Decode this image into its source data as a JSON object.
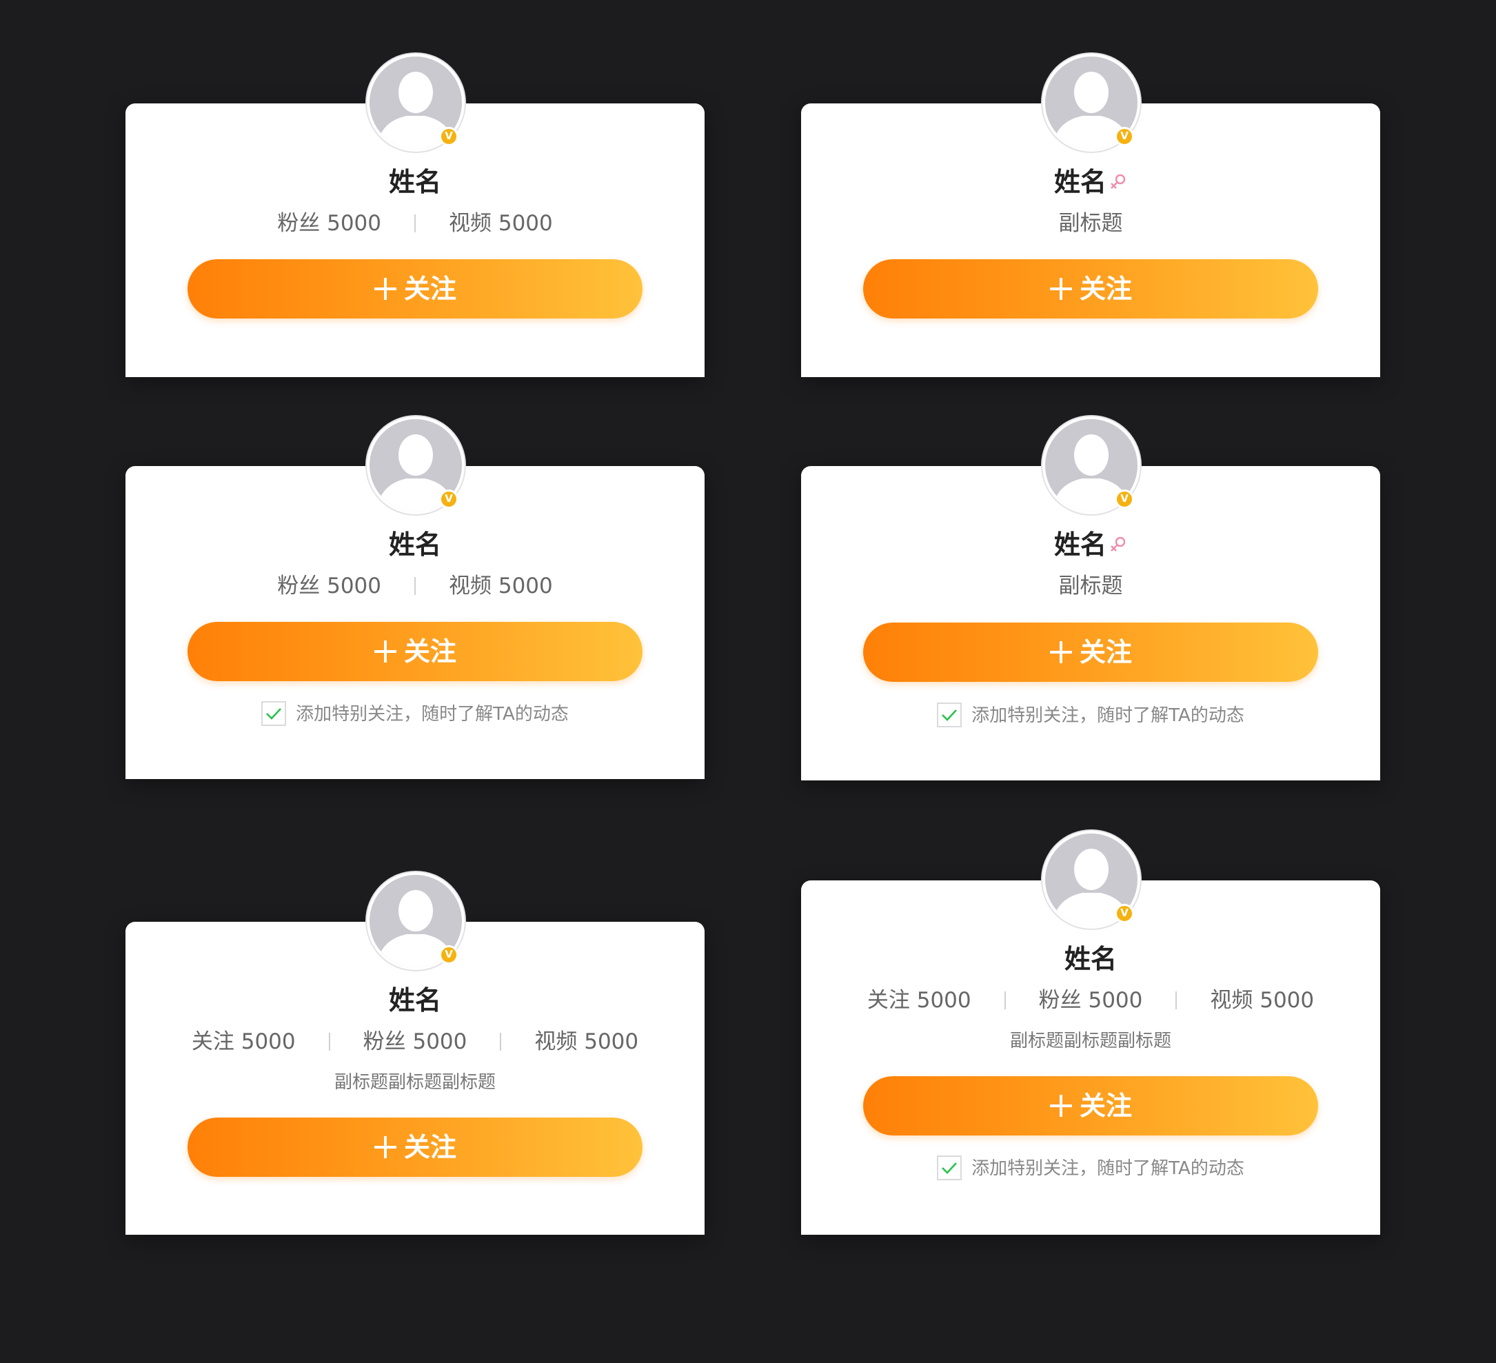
{
  "colors": {
    "page_background": "#1c1c1e",
    "card_background": "#ffffff",
    "button_gradient_start": "#ff8008",
    "button_gradient_end": "#ffc23a",
    "verified_badge": "#f5b210",
    "female_icon": "#f08cab",
    "checkmark": "#27c24c"
  },
  "icons": {
    "avatar": "default-user-silhouette",
    "verified": "v-badge",
    "gender": "female-symbol",
    "plus": "plus",
    "check": "checkmark"
  },
  "verified_badge_label": "V",
  "cards": [
    {
      "name": "姓名",
      "stats": [
        {
          "label": "粉丝 5000"
        },
        {
          "label": "视频 5000"
        }
      ],
      "follow_label": "关注"
    },
    {
      "name": "姓名",
      "subtitle": "副标题",
      "follow_label": "关注"
    },
    {
      "name": "姓名",
      "stats": [
        {
          "label": "粉丝 5000"
        },
        {
          "label": "视频 5000"
        }
      ],
      "follow_label": "关注",
      "special_follow_label": "添加特别关注，随时了解TA的动态",
      "special_follow_checked": true
    },
    {
      "name": "姓名",
      "subtitle": "副标题",
      "follow_label": "关注",
      "special_follow_label": "添加特别关注，随时了解TA的动态",
      "special_follow_checked": true
    },
    {
      "name": "姓名",
      "stats": [
        {
          "label": "关注 5000"
        },
        {
          "label": "粉丝 5000"
        },
        {
          "label": "视频 5000"
        }
      ],
      "subtitle": "副标题副标题副标题",
      "follow_label": "关注"
    },
    {
      "name": "姓名",
      "stats": [
        {
          "label": "关注 5000"
        },
        {
          "label": "粉丝 5000"
        },
        {
          "label": "视频 5000"
        }
      ],
      "subtitle": "副标题副标题副标题",
      "follow_label": "关注",
      "special_follow_label": "添加特别关注，随时了解TA的动态",
      "special_follow_checked": true
    }
  ]
}
